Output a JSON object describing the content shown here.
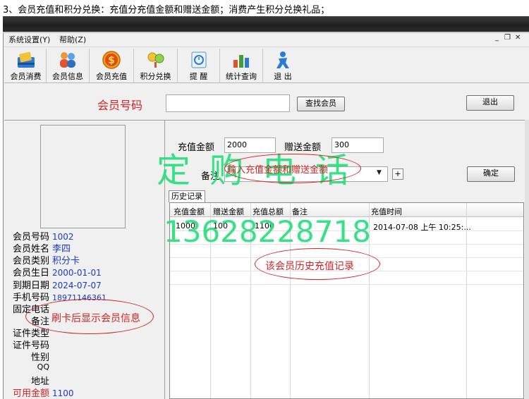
{
  "caption": "3、会员充值和积分兑换：充值分充值金额和赠送金额；消费产生积分兑换礼品；",
  "menu": [
    "系统设置(Y)",
    "帮助(Z)"
  ],
  "mdi": {
    "minimize": "_",
    "restore": "❐",
    "close": "✕"
  },
  "toolbar": [
    {
      "label": "会员消费",
      "icon": "member-consume-icon"
    },
    {
      "label": "会员信息",
      "icon": "member-info-icon"
    },
    {
      "label": "会员充值",
      "icon": "recharge-icon"
    },
    {
      "label": "积分兑换",
      "icon": "points-exchange-icon"
    },
    {
      "label": "提 醒",
      "icon": "reminder-icon"
    },
    {
      "label": "统计查询",
      "icon": "statistics-icon"
    },
    {
      "label": "退 出",
      "icon": "exit-icon"
    }
  ],
  "search": {
    "label": "会员号码",
    "value": "",
    "find_button": "查找会员",
    "exit_button": "退出"
  },
  "member_info": [
    {
      "label": "会员号码",
      "value": "1002"
    },
    {
      "label": "会员姓名",
      "value": "李四"
    },
    {
      "label": "会员类别",
      "value": "积分卡"
    },
    {
      "label": "会员生日",
      "value": "2000-01-01"
    },
    {
      "label": "到期日期",
      "value": "2024-07-07"
    },
    {
      "label": "手机号码",
      "value": "18971146361"
    },
    {
      "label": "固定电话",
      "value": ""
    },
    {
      "label": "备注",
      "value": ""
    },
    {
      "label": "证件类型",
      "value": ""
    },
    {
      "label": "证件号码",
      "value": ""
    },
    {
      "label": "性别",
      "value": ""
    },
    {
      "label": "QQ",
      "value": ""
    },
    {
      "label": "地址",
      "value": ""
    },
    {
      "label": "可用金额",
      "value": "1100"
    }
  ],
  "recharge": {
    "amount_label": "充值金额",
    "amount_value": "2000",
    "gift_label": "赠送金额",
    "gift_value": "300",
    "remark_label": "备注",
    "remark_value": "",
    "plus_label": "+",
    "ok_button": "确定"
  },
  "history": {
    "tab": "历史记录",
    "columns": [
      "充值金额",
      "赠送金额",
      "充值总额",
      "备注",
      "充值时间"
    ],
    "rows": [
      [
        "1000",
        "100",
        "1100",
        "",
        "2014-07-08 上午 10:25:..."
      ]
    ]
  },
  "watermark": {
    "text": "定购电话",
    "phone": "13628228718"
  },
  "annotations": {
    "input_note": "输入充值金额和赠送金额",
    "history_note": "该会员历史充值记录",
    "info_note": "刷卡后显示会员信息"
  },
  "colors": {
    "annotation": "#d42424",
    "watermark": "#25e07a",
    "value_blue": "#1b38c9"
  }
}
